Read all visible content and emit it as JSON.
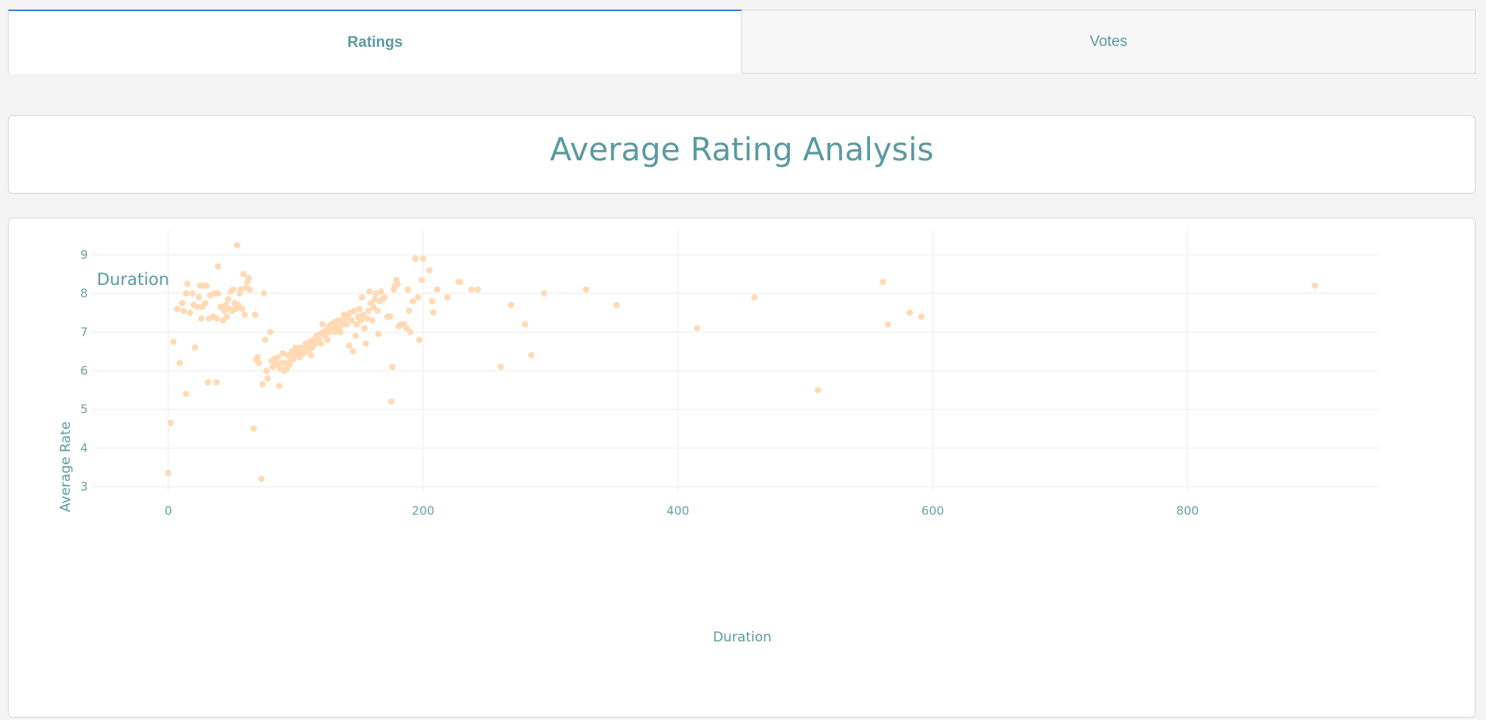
{
  "tabs": [
    {
      "label": "Ratings",
      "active": true
    },
    {
      "label": "Votes",
      "active": false
    }
  ],
  "page_title": "Average Rating Analysis",
  "colors": {
    "accent": "#5a9aa0",
    "tab_border": "#3f7fd6",
    "marker": "#ffdab5",
    "grid": "#eeeeee"
  },
  "chart_data": {
    "type": "scatter",
    "title": "Duration",
    "xlabel": "Duration",
    "ylabel": "Average Rate",
    "xlim": [
      -60,
      950
    ],
    "ylim": [
      2.85,
      9.65
    ],
    "xticks": [
      0,
      200,
      400,
      600,
      800
    ],
    "yticks": [
      3,
      4,
      5,
      6,
      7,
      8,
      9
    ],
    "grid": true,
    "series": [
      {
        "points": [
          [
            0,
            3.35
          ],
          [
            2,
            4.65
          ],
          [
            4,
            6.75
          ],
          [
            7,
            7.6
          ],
          [
            9,
            6.2
          ],
          [
            11,
            7.75
          ],
          [
            12,
            7.55
          ],
          [
            14,
            8.0
          ],
          [
            14,
            5.4
          ],
          [
            15,
            8.25
          ],
          [
            17,
            7.5
          ],
          [
            19,
            8.0
          ],
          [
            20,
            7.7
          ],
          [
            21,
            6.6
          ],
          [
            23,
            7.65
          ],
          [
            24,
            7.9
          ],
          [
            25,
            8.2
          ],
          [
            26,
            7.35
          ],
          [
            27,
            7.65
          ],
          [
            28,
            8.2
          ],
          [
            29,
            7.75
          ],
          [
            30,
            8.2
          ],
          [
            31,
            5.7
          ],
          [
            32,
            7.35
          ],
          [
            33,
            7.95
          ],
          [
            35,
            7.4
          ],
          [
            36,
            8.0
          ],
          [
            38,
            7.35
          ],
          [
            38,
            5.7
          ],
          [
            39,
            8.0
          ],
          [
            39,
            8.7
          ],
          [
            41,
            7.65
          ],
          [
            43,
            7.3
          ],
          [
            44,
            7.55
          ],
          [
            45,
            7.7
          ],
          [
            46,
            7.4
          ],
          [
            47,
            7.85
          ],
          [
            48,
            7.6
          ],
          [
            49,
            8.05
          ],
          [
            50,
            7.55
          ],
          [
            51,
            8.1
          ],
          [
            52,
            7.75
          ],
          [
            53,
            7.6
          ],
          [
            54,
            9.25
          ],
          [
            55,
            7.7
          ],
          [
            56,
            8.0
          ],
          [
            57,
            8.1
          ],
          [
            58,
            7.6
          ],
          [
            59,
            8.5
          ],
          [
            60,
            7.45
          ],
          [
            61,
            8.15
          ],
          [
            62,
            8.3
          ],
          [
            63,
            8.4
          ],
          [
            64,
            8.1
          ],
          [
            67,
            4.5
          ],
          [
            68,
            7.45
          ],
          [
            69,
            6.3
          ],
          [
            70,
            6.35
          ],
          [
            71,
            6.2
          ],
          [
            73,
            3.2
          ],
          [
            74,
            5.65
          ],
          [
            75,
            8.0
          ],
          [
            76,
            6.8
          ],
          [
            77,
            6.0
          ],
          [
            78,
            5.8
          ],
          [
            80,
            7.0
          ],
          [
            81,
            6.25
          ],
          [
            82,
            6.1
          ],
          [
            83,
            6.3
          ],
          [
            84,
            6.2
          ],
          [
            85,
            6.15
          ],
          [
            86,
            6.35
          ],
          [
            87,
            5.6
          ],
          [
            88,
            6.05
          ],
          [
            89,
            6.2
          ],
          [
            90,
            6.45
          ],
          [
            91,
            6.0
          ],
          [
            92,
            6.2
          ],
          [
            93,
            6.05
          ],
          [
            94,
            6.4
          ],
          [
            95,
            6.15
          ],
          [
            96,
            6.25
          ],
          [
            97,
            6.5
          ],
          [
            98,
            6.3
          ],
          [
            99,
            6.4
          ],
          [
            100,
            6.6
          ],
          [
            101,
            6.45
          ],
          [
            102,
            6.5
          ],
          [
            103,
            6.35
          ],
          [
            104,
            6.6
          ],
          [
            105,
            6.5
          ],
          [
            106,
            6.45
          ],
          [
            107,
            6.55
          ],
          [
            108,
            6.7
          ],
          [
            109,
            6.6
          ],
          [
            110,
            6.5
          ],
          [
            111,
            6.75
          ],
          [
            112,
            6.4
          ],
          [
            113,
            6.6
          ],
          [
            114,
            6.8
          ],
          [
            115,
            6.7
          ],
          [
            116,
            6.9
          ],
          [
            117,
            6.75
          ],
          [
            118,
            6.8
          ],
          [
            119,
            6.95
          ],
          [
            120,
            6.7
          ],
          [
            121,
            7.2
          ],
          [
            122,
            7.0
          ],
          [
            123,
            6.9
          ],
          [
            124,
            7.05
          ],
          [
            125,
            6.8
          ],
          [
            126,
            7.15
          ],
          [
            127,
            7.0
          ],
          [
            128,
            7.2
          ],
          [
            129,
            7.1
          ],
          [
            130,
            7.25
          ],
          [
            131,
            7.0
          ],
          [
            132,
            7.15
          ],
          [
            133,
            7.3
          ],
          [
            134,
            7.1
          ],
          [
            135,
            7.0
          ],
          [
            136,
            7.3
          ],
          [
            137,
            7.2
          ],
          [
            138,
            7.45
          ],
          [
            139,
            7.35
          ],
          [
            140,
            7.2
          ],
          [
            141,
            7.4
          ],
          [
            142,
            6.65
          ],
          [
            143,
            7.5
          ],
          [
            144,
            7.3
          ],
          [
            145,
            6.5
          ],
          [
            146,
            7.55
          ],
          [
            147,
            6.9
          ],
          [
            148,
            7.2
          ],
          [
            149,
            7.4
          ],
          [
            150,
            7.6
          ],
          [
            151,
            7.3
          ],
          [
            152,
            7.9
          ],
          [
            153,
            7.45
          ],
          [
            154,
            7.1
          ],
          [
            155,
            6.7
          ],
          [
            156,
            7.35
          ],
          [
            157,
            7.55
          ],
          [
            158,
            8.05
          ],
          [
            159,
            7.75
          ],
          [
            160,
            7.3
          ],
          [
            161,
            7.65
          ],
          [
            162,
            7.85
          ],
          [
            163,
            8.0
          ],
          [
            164,
            7.55
          ],
          [
            165,
            6.95
          ],
          [
            166,
            7.8
          ],
          [
            167,
            8.05
          ],
          [
            168,
            7.85
          ],
          [
            170,
            7.9
          ],
          [
            172,
            7.4
          ],
          [
            174,
            7.4
          ],
          [
            175,
            5.2
          ],
          [
            176,
            6.1
          ],
          [
            177,
            8.1
          ],
          [
            178,
            8.2
          ],
          [
            179,
            8.35
          ],
          [
            180,
            8.25
          ],
          [
            181,
            7.15
          ],
          [
            183,
            7.2
          ],
          [
            185,
            7.2
          ],
          [
            187,
            7.1
          ],
          [
            188,
            8.1
          ],
          [
            189,
            7.55
          ],
          [
            190,
            7.0
          ],
          [
            192,
            7.8
          ],
          [
            194,
            8.9
          ],
          [
            196,
            7.9
          ],
          [
            197,
            6.8
          ],
          [
            199,
            8.35
          ],
          [
            200,
            8.9
          ],
          [
            205,
            8.6
          ],
          [
            207,
            7.8
          ],
          [
            208,
            7.5
          ],
          [
            211,
            8.1
          ],
          [
            219,
            7.9
          ],
          [
            228,
            8.3
          ],
          [
            229,
            8.3
          ],
          [
            238,
            8.1
          ],
          [
            243,
            8.1
          ],
          [
            261,
            6.1
          ],
          [
            269,
            7.7
          ],
          [
            280,
            7.2
          ],
          [
            285,
            6.4
          ],
          [
            295,
            8.0
          ],
          [
            328,
            8.1
          ],
          [
            352,
            7.7
          ],
          [
            415,
            7.1
          ],
          [
            460,
            7.9
          ],
          [
            510,
            5.5
          ],
          [
            561,
            8.3
          ],
          [
            565,
            7.2
          ],
          [
            582,
            7.5
          ],
          [
            591,
            7.4
          ],
          [
            900,
            8.2
          ]
        ]
      }
    ]
  }
}
